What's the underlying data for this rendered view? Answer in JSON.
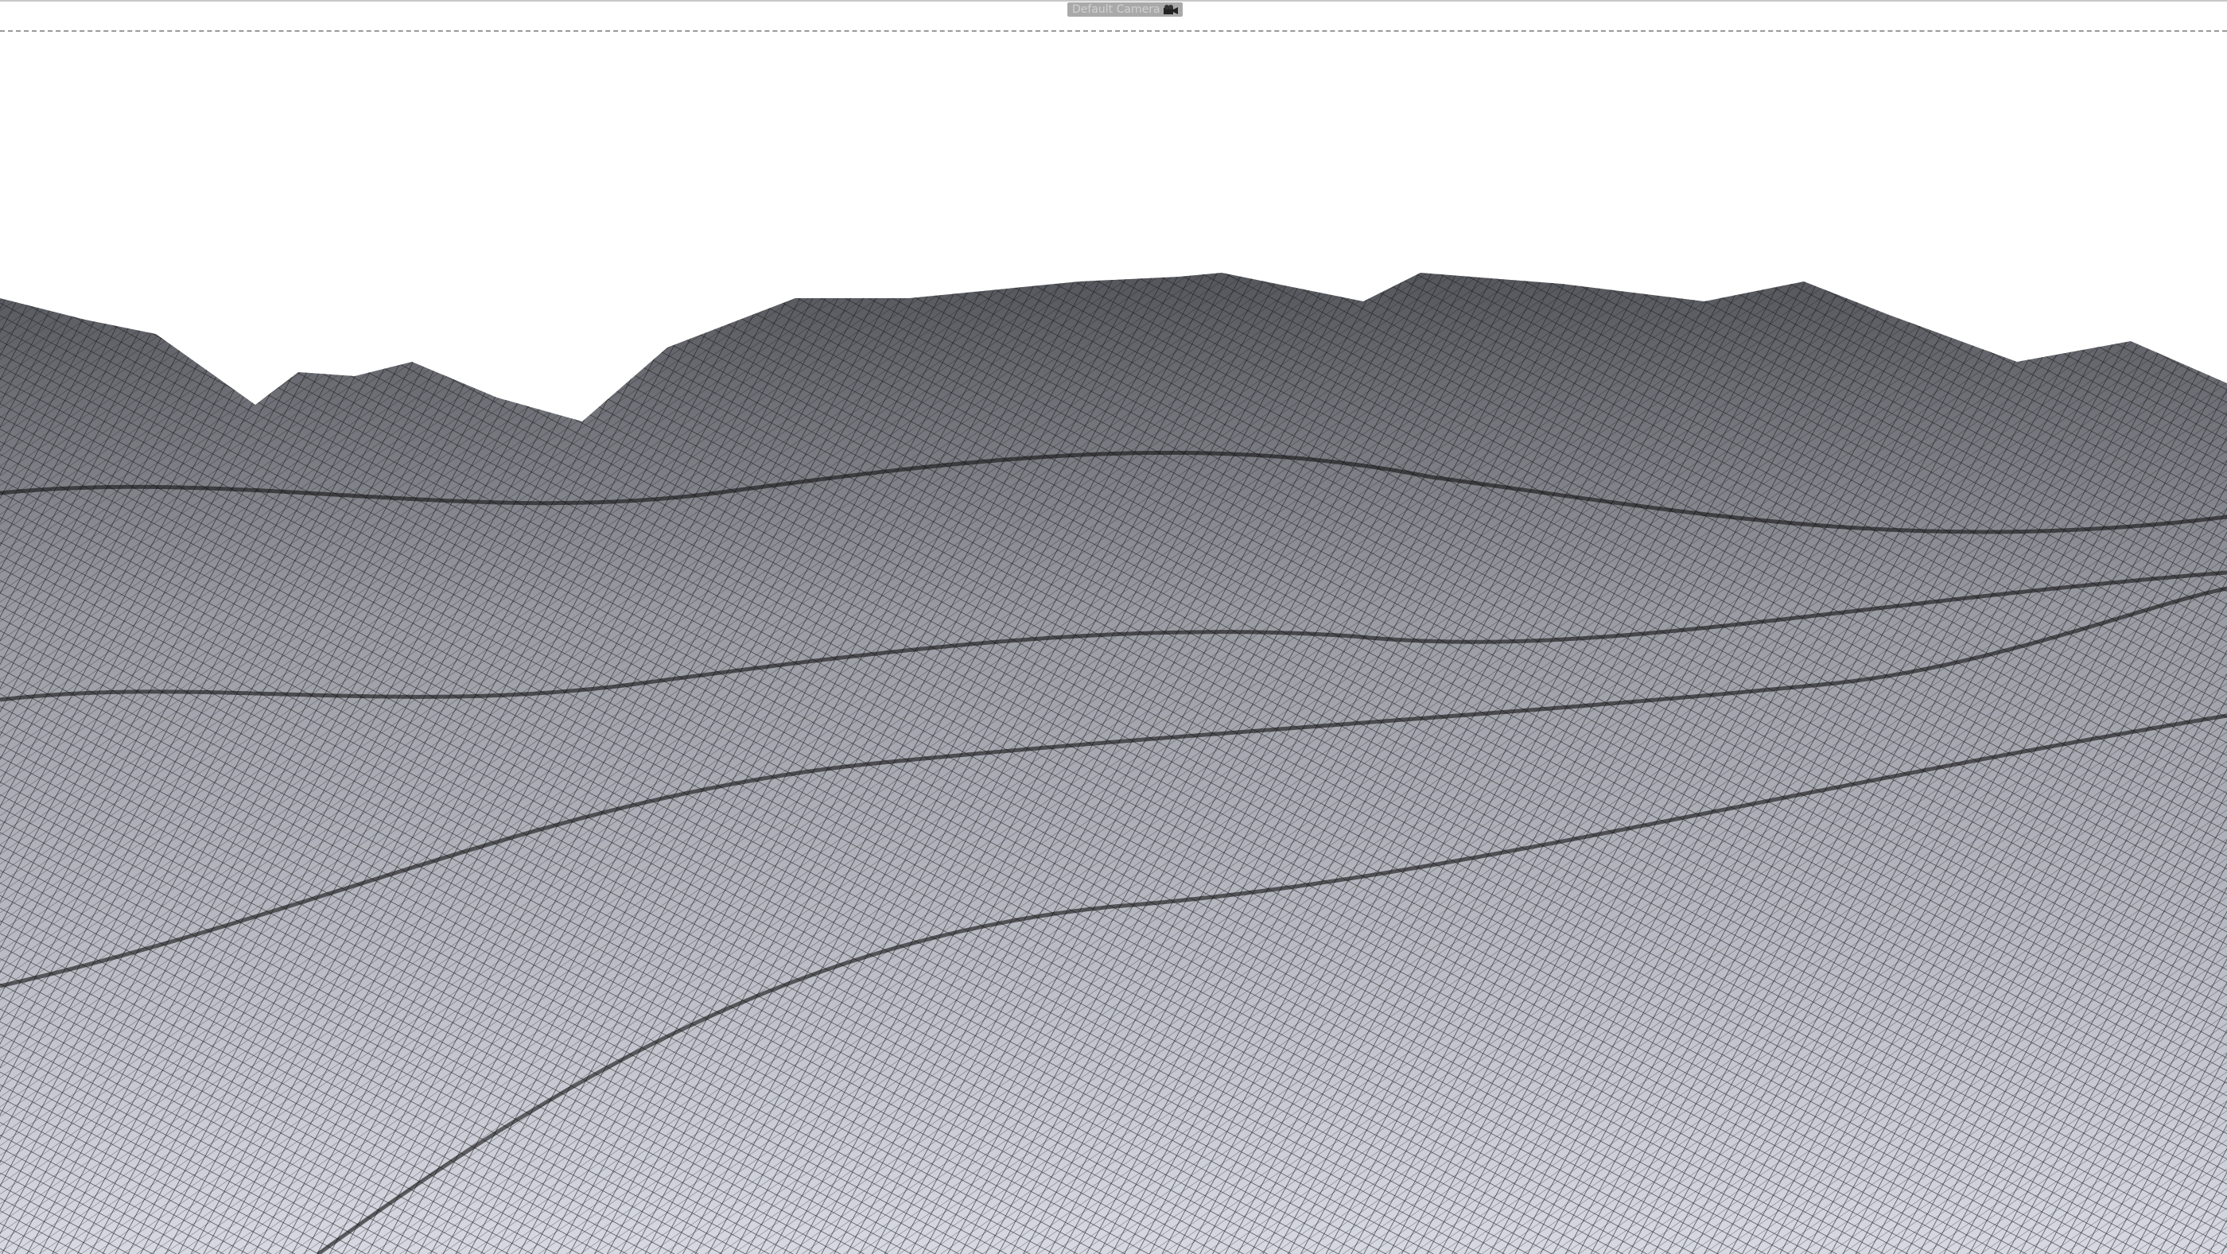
{
  "viewport": {
    "camera_label": "Default Camera",
    "camera_icon": "camera-icon"
  },
  "colors": {
    "mesh_line": "#1a1a1a",
    "surface_light": "#e4e6ee",
    "surface_dark": "#6f7078"
  }
}
